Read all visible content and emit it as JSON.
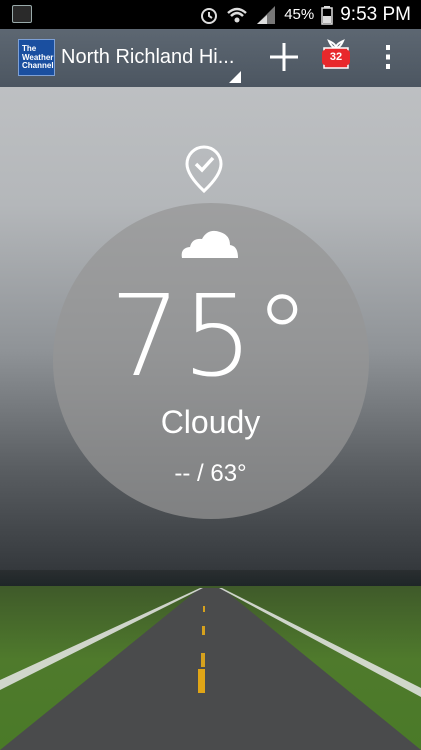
{
  "status_bar": {
    "battery": "45%",
    "time": "9:53 PM"
  },
  "app_bar": {
    "logo_text": [
      "The",
      "Weather",
      "Channel"
    ],
    "location": "North Richland Hi...",
    "gift_count": "32"
  },
  "weather": {
    "temperature": "75°",
    "condition": "Cloudy",
    "hi_lo": "-- / 63°"
  },
  "icons": [
    "location-check-icon",
    "cloud-icon",
    "plus-icon",
    "gift-icon",
    "overflow-menu-icon",
    "alarm-icon",
    "wifi-icon",
    "signal-icon",
    "battery-icon"
  ]
}
